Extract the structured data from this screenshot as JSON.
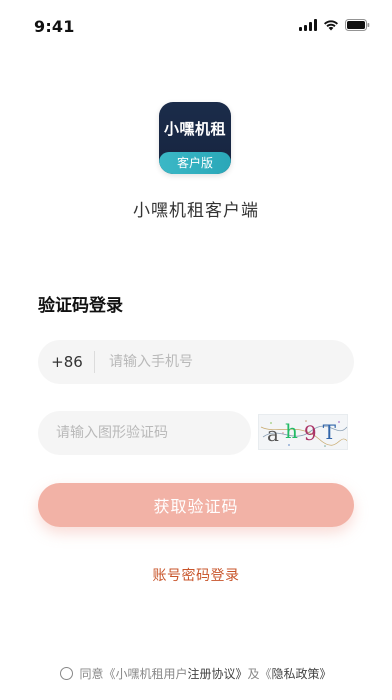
{
  "status_bar": {
    "time": "9:41"
  },
  "app": {
    "logo_name": "小嘿机租",
    "logo_tag": "客户版",
    "title": "小嘿机租客户端"
  },
  "login": {
    "section_title": "验证码登录",
    "country_code": "+86",
    "phone_placeholder": "请输入手机号",
    "captcha_placeholder": "请输入图形验证码",
    "captcha_text": "ah9T",
    "get_code_label": "获取验证码",
    "password_login_label": "账号密码登录"
  },
  "agreement": {
    "prefix": "同意",
    "user_agreement_pre": "《小嘿机租用户",
    "user_agreement_link": "注册协议》",
    "and": "及",
    "privacy_pre": "《",
    "privacy_link": "隐私政策》"
  },
  "colors": {
    "accent_button": "#f2b2a6",
    "link": "#c8552b",
    "logo_bg": "#1b2c4a",
    "logo_tag": "#3bb8c6"
  },
  "icons": [
    "signal-icon",
    "wifi-icon",
    "battery-icon"
  ]
}
